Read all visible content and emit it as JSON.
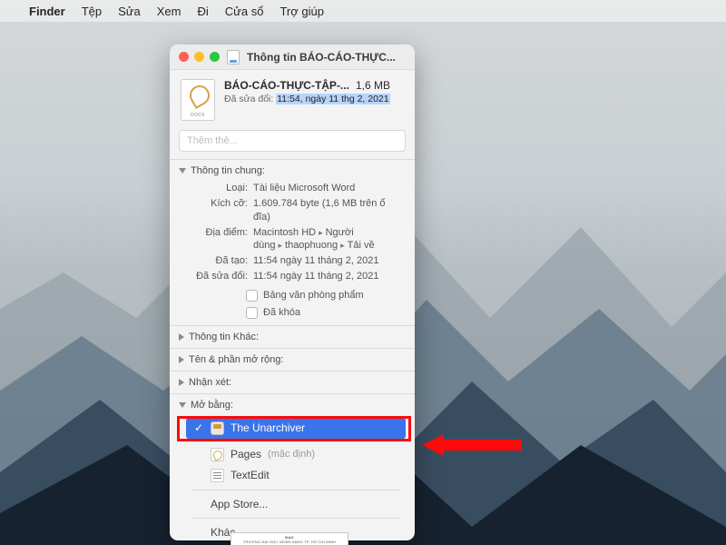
{
  "menubar": {
    "app": "Finder",
    "items": [
      "Tệp",
      "Sửa",
      "Xem",
      "Đi",
      "Cửa sổ",
      "Trợ giúp"
    ]
  },
  "window": {
    "title": "Thông tin BÁO-CÁO-THỰC..."
  },
  "header": {
    "filename": "BÁO-CÁO-THỰC-TẬP-...",
    "size": "1,6 MB",
    "modified_label": "Đã sửa đổi:",
    "modified_value": "11:54, ngày 11 thg 2, 2021"
  },
  "tags_placeholder": "Thêm thẻ...",
  "sections": {
    "general": {
      "title": "Thông tin chung:",
      "rows": {
        "kind_k": "Loại:",
        "kind_v": "Tài liệu Microsoft Word",
        "size_k": "Kích cỡ:",
        "size_v": "1.609.784 byte (1,6 MB trên ổ đĩa)",
        "where_k": "Địa điểm:",
        "where_parts": [
          "Macintosh HD",
          "Người dùng",
          "thaophuong",
          "Tải về"
        ],
        "created_k": "Đã tạo:",
        "created_v": "11:54 ngày 11 tháng 2, 2021",
        "modified_k": "Đã sửa đổi:",
        "modified_v": "11:54 ngày 11 tháng 2, 2021"
      },
      "checkboxes": {
        "stationery": "Bảng văn phòng phẩm",
        "locked": "Đã khóa"
      }
    },
    "more_info": "Thông tin Khác:",
    "name_ext": "Tên & phần mở rộng:",
    "comments": "Nhận xét:",
    "open_with": "Mở bằng:"
  },
  "open_with_menu": {
    "selected": "The Unarchiver",
    "pages": "Pages",
    "pages_default": "(mặc định)",
    "textedit": "TextEdit",
    "app_store": "App Store...",
    "other": "Khác..."
  },
  "doc_thumb": "TRƯỜNG ĐẠI HỌC NGÂN HÀNG TP. HỒ CHÍ MINH"
}
